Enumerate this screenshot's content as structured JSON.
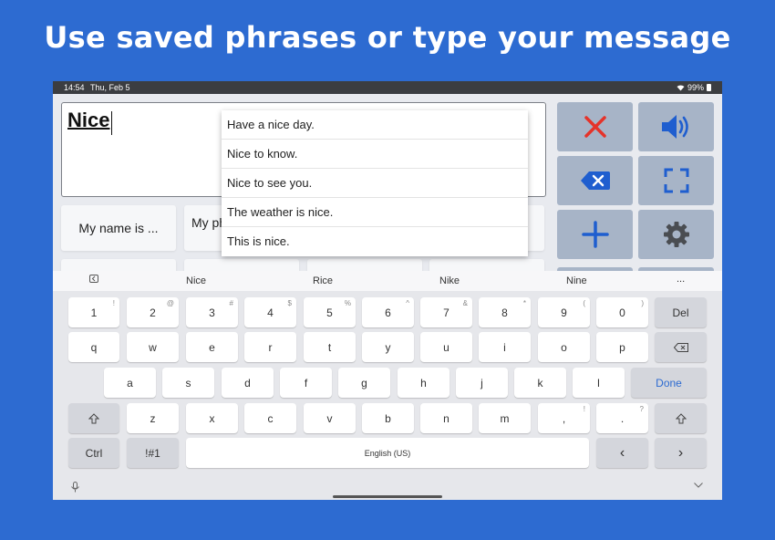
{
  "headline": "Use saved phrases or type your message",
  "status": {
    "time": "14:54",
    "date": "Thu, Feb 5",
    "battery": "99%"
  },
  "textbox": {
    "value": "Nice"
  },
  "phrases": [
    "My name is ...",
    "My ph"
  ],
  "dropdown": [
    "Have a nice day.",
    "Nice to know.",
    "Nice to see you.",
    "The weather is nice.",
    "This is nice."
  ],
  "suggestions": [
    "Nice",
    "Rice",
    "Nike",
    "Nine",
    "..."
  ],
  "keyboard": {
    "row1": [
      {
        "label": "1",
        "hint": "!"
      },
      {
        "label": "2",
        "hint": "@"
      },
      {
        "label": "3",
        "hint": "#"
      },
      {
        "label": "4",
        "hint": "$"
      },
      {
        "label": "5",
        "hint": "%"
      },
      {
        "label": "6",
        "hint": "^"
      },
      {
        "label": "7",
        "hint": "&"
      },
      {
        "label": "8",
        "hint": "*"
      },
      {
        "label": "9",
        "hint": "("
      },
      {
        "label": "0",
        "hint": ")"
      },
      {
        "label": "Del",
        "hint": ""
      }
    ],
    "row2": [
      "q",
      "w",
      "e",
      "r",
      "t",
      "y",
      "u",
      "i",
      "o",
      "p"
    ],
    "row3": [
      "a",
      "s",
      "d",
      "f",
      "g",
      "h",
      "j",
      "k",
      "l"
    ],
    "done": "Done",
    "row4": [
      "z",
      "x",
      "c",
      "v",
      "b",
      "n",
      "m"
    ],
    "comma": {
      "label": ",",
      "hint": "!"
    },
    "period": {
      "label": ".",
      "hint": "?"
    },
    "ctrl": "Ctrl",
    "symbols": "!#1",
    "space": "English (US)",
    "left": "‹",
    "right": "›"
  },
  "colors": {
    "background": "#2d6bd1",
    "accent": "#2d6bd1",
    "clear_red": "#e5332a"
  },
  "icons": [
    "clear-icon",
    "speaker-icon",
    "backspace-icon",
    "fullscreen-icon",
    "add-icon",
    "settings-icon"
  ]
}
